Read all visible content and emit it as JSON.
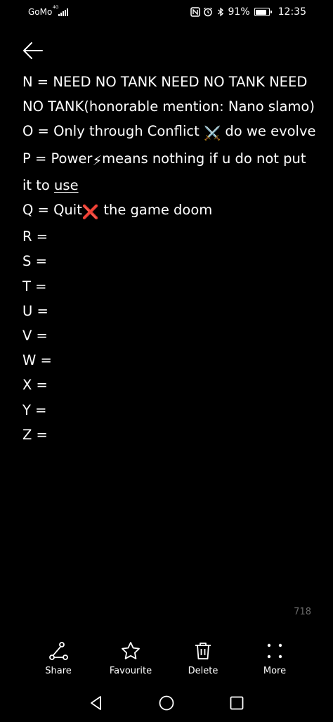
{
  "status_bar": {
    "carrier": "GoMo",
    "network": "4G",
    "battery_percent": "91%",
    "battery_level": 0.91,
    "time": "12:35"
  },
  "note": {
    "lines": [
      {
        "text": "N = NEED NO TANK NEED NO TANK NEED"
      },
      {
        "text": "NO TANK(honorable mention: Nano slamo)"
      },
      {
        "prefix": "O = Only through Conflict ",
        "emoji": "⚔️",
        "suffix": " do we evolve"
      },
      {
        "prefix": "P = Power",
        "emoji": "⚡",
        "suffix": "means nothing if u do not put"
      },
      {
        "prefix": "it to ",
        "underlined": "use"
      },
      {
        "prefix": "Q = Quit",
        "emoji": "❌",
        "suffix": " the game doom"
      },
      {
        "text": "R ="
      },
      {
        "text": "S ="
      },
      {
        "text": "T ="
      },
      {
        "text": "U ="
      },
      {
        "text": "V ="
      },
      {
        "text": "W ="
      },
      {
        "text": "X ="
      },
      {
        "text": "Y ="
      },
      {
        "text": "Z ="
      }
    ],
    "char_count": "718"
  },
  "toolbar": {
    "share_label": "Share",
    "favourite_label": "Favourite",
    "delete_label": "Delete",
    "more_label": "More"
  },
  "icons": {
    "back": "arrow-left-icon",
    "share": "share-icon",
    "favourite": "star-icon",
    "delete": "trash-icon",
    "more": "dots-icon",
    "nav_back": "triangle-back-icon",
    "nav_home": "circle-home-icon",
    "nav_recents": "square-recents-icon"
  },
  "colors": {
    "background": "#000000",
    "text": "#ffffff",
    "muted": "#6b6b6b"
  }
}
